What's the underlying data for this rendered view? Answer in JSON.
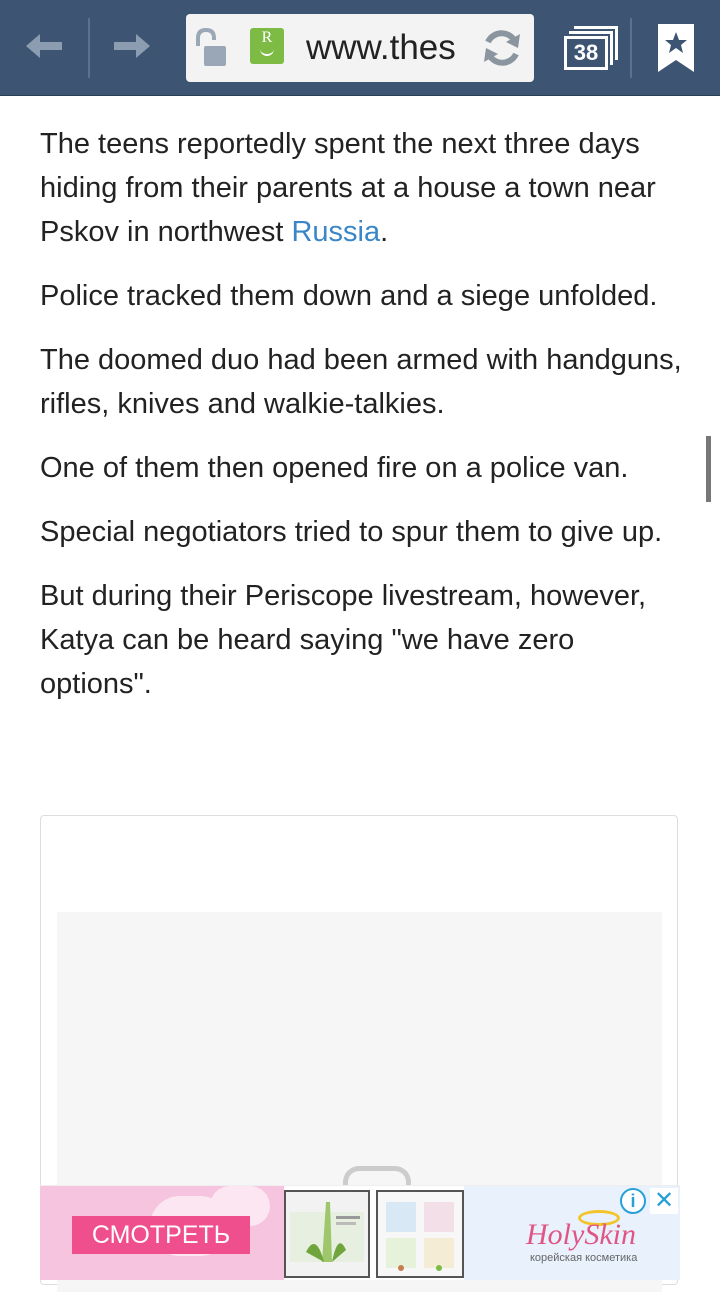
{
  "browser": {
    "url": "www.thes",
    "tab_count": "38",
    "site_icon_letter": "R",
    "toolbar_color": "#3d5573"
  },
  "article": {
    "p1_before": "The teens reportedly spent the next three days hiding from their parents at a house a town near Pskov in northwest ",
    "p1_link": "Russia",
    "p1_after": ".",
    "p2": "Police tracked them down and a siege unfolded.",
    "p3": "The doomed duo had been armed with handguns, rifles, knives and walkie-talkies.",
    "p4": "One of them then opened fire on a police van.",
    "p5": "Special negotiators tried to spur them to give up.",
    "p6": "But during their Periscope livestream, however, Katya can be heard saying \"we have zero options\".",
    "link_color": "#3a86c8"
  },
  "ad": {
    "cta_label": "СМОТРЕТЬ",
    "brand": "HolySkin",
    "brand_sub": "корейская косметика",
    "info_icon": "i",
    "close_icon": "✕"
  }
}
